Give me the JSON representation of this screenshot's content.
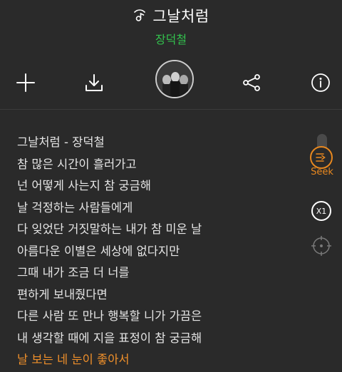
{
  "header": {
    "title": "그날처럼",
    "artist": "장덕철",
    "icons": [
      "music-note-icon"
    ]
  },
  "toolbar": {
    "buttons": [
      {
        "name": "add",
        "icon": "plus-icon"
      },
      {
        "name": "download",
        "icon": "download-icon"
      },
      {
        "name": "album-art",
        "icon": "album-cover"
      },
      {
        "name": "share",
        "icon": "share-icon"
      },
      {
        "name": "info",
        "icon": "info-icon"
      }
    ]
  },
  "lyrics": {
    "lines": [
      "그날처럼 - 장덕철",
      "참 많은 시간이 흘러가고",
      "넌 어떻게 사는지 참 궁금해",
      "날 걱정하는 사람들에게",
      "다 잊었단 거짓말하는 내가 참 미운 날",
      "아름다운 이별은 세상에 없다지만",
      "그때 내가 조금 더 너를",
      "편하게 보내줬다면",
      "다른 사람 또 만나 행복할 니가 가끔은",
      "내 생각할 때에 지을 표정이 참 궁금해",
      "날 보는 네 눈이 좋아서"
    ],
    "current_index": 10
  },
  "side": {
    "seek_label": "Seek",
    "speed_label": "X1"
  },
  "colors": {
    "background": "#2a2a2a",
    "artist_green": "#32c24d",
    "accent_orange": "#e8881f",
    "current_line": "#f0902a"
  }
}
